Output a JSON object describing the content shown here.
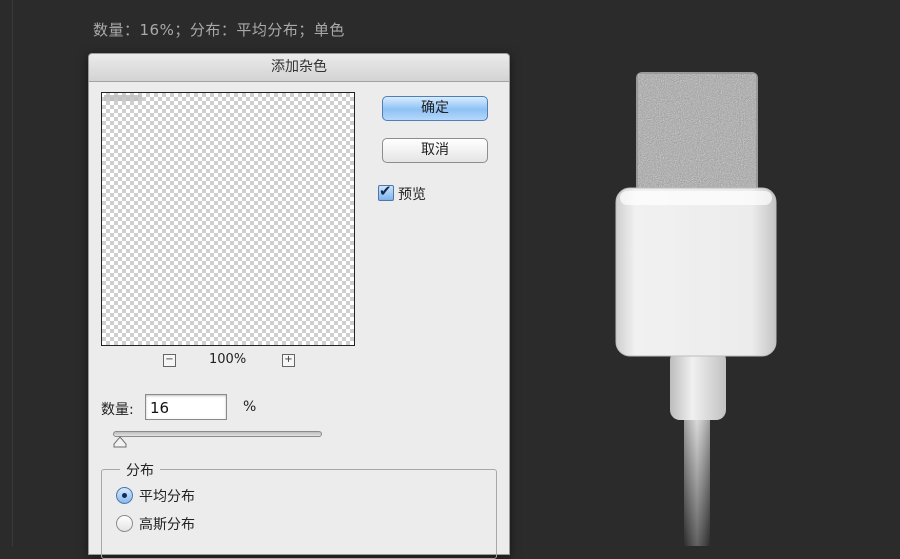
{
  "caption": "数量：16%；分布：平均分布；单色",
  "dialog": {
    "title": "添加杂色",
    "ok_label": "确定",
    "cancel_label": "取消",
    "preview_label": "预览",
    "preview_checked": true,
    "zoom": {
      "value": "100%",
      "minus": "−",
      "plus": "+"
    },
    "amount": {
      "label": "数量:",
      "value": "16",
      "unit": "%",
      "slider_fraction": 0.0
    },
    "distribution": {
      "legend": "分布",
      "options": [
        {
          "label": "平均分布",
          "selected": true
        },
        {
          "label": "高斯分布",
          "selected": false
        }
      ]
    }
  },
  "colors": {
    "background": "#2b2b2b",
    "dialog_bg": "#ececec",
    "ok_button": "#8ec1f4",
    "connector_body": "#e6e6e6",
    "noise_gray": "#a0a0a0"
  },
  "icons": {
    "zoom_out": "minus-square-icon",
    "zoom_in": "plus-square-icon",
    "checkbox": "checkmark-icon",
    "slider": "triangle-thumb-icon"
  }
}
